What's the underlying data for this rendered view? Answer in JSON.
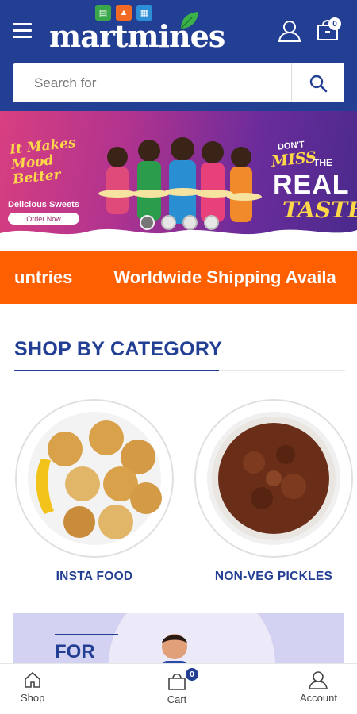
{
  "header": {
    "logo_text": "martmines",
    "cart_count": "0",
    "colors": {
      "brand": "#233f94",
      "accent": "#fe5f00"
    }
  },
  "search": {
    "placeholder": "Search for"
  },
  "banner": {
    "left_tagline": "It Makes Mood Better",
    "product": "Delicious Sweets",
    "cta": "Order Now",
    "right_top": "DON'T",
    "right_miss": "MISS",
    "right_the": "THE",
    "right_real": "REAL",
    "right_taste": "TASTE",
    "slide_count": 4,
    "active_slide": 1
  },
  "ticker": {
    "part1": "untries",
    "part2": "Worldwide Shipping Availa"
  },
  "section": {
    "title": "SHOP BY CATEGORY"
  },
  "categories": [
    {
      "label": "INSTA FOOD"
    },
    {
      "label": "NON-VEG PICKLES"
    }
  ],
  "promo": {
    "text": "FOR"
  },
  "bottom_nav": {
    "shop": "Shop",
    "cart": "Cart",
    "cart_count": "0",
    "account": "Account"
  }
}
